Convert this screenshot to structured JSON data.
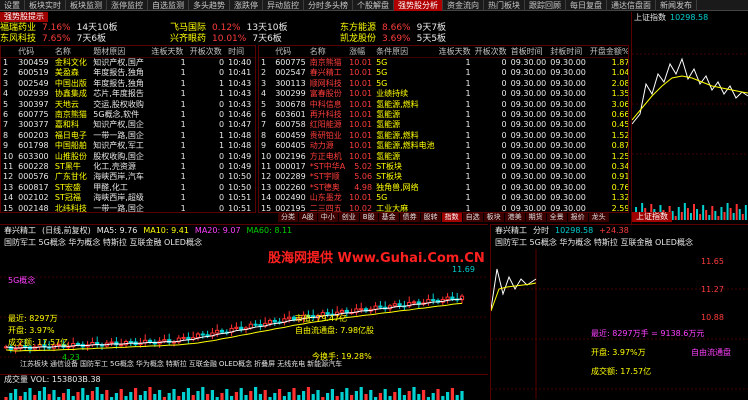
{
  "tabs": [
    "设置",
    "板块实时",
    "板块监测",
    "涨停监控",
    "自选监测",
    "多头趋势",
    "涨跌停",
    "异动监控",
    "分时多头榜",
    "个股解盘",
    "强势股分析",
    "资金流向",
    "热门板块",
    "跟踪回顾",
    "每日复盘",
    "通达信盘面",
    "新闻发布"
  ],
  "active_tab": "强势股分析",
  "subtab": "强势股提示",
  "summary": {
    "row1": [
      {
        "name": "福瑞药业",
        "pct": "7.16%",
        "tag": "14天10板"
      },
      {
        "name": "飞马国际",
        "pct": "0.12%",
        "tag": "13天10板"
      },
      {
        "name": "东方能源",
        "pct": "8.66%",
        "tag": "9天7板"
      }
    ],
    "row2": [
      {
        "name": "东风科技",
        "pct": "7.65%",
        "tag": "7天6板"
      },
      {
        "name": "兴齐眼药",
        "pct": "10.01%",
        "tag": "7天6板"
      },
      {
        "name": "凯龙股份",
        "pct": "3.69%",
        "tag": "5天5板"
      }
    ]
  },
  "left_table": {
    "headers": [
      "",
      "代码",
      "名称",
      "题材原因",
      "连板天数",
      "开板次数",
      "时间"
    ],
    "rows": [
      [
        "1",
        "300459",
        "金科文化",
        "知识产权,国产",
        "1",
        "0",
        "10:40"
      ],
      [
        "2",
        "600519",
        "美盈森",
        "年度报告,独角",
        "1",
        "0",
        "10:41"
      ],
      [
        "3",
        "002549",
        "中国出版",
        "年度报告,独角",
        "1",
        "1",
        "10:43"
      ],
      [
        "4",
        "002939",
        "协鑫集成",
        "芯片,年度报告",
        "1",
        "1",
        "10:43"
      ],
      [
        "5",
        "300397",
        "天地云",
        "交运,股权收购",
        "1",
        "0",
        "10:43"
      ],
      [
        "6",
        "600775",
        "南京熊猫",
        "5G概念,软件",
        "1",
        "0",
        "10:46"
      ],
      [
        "7",
        "300377",
        "嘉和科",
        "知识产权,国企",
        "1",
        "0",
        "10:47"
      ],
      [
        "8",
        "600203",
        "福日电子",
        "一带一路,国企",
        "1",
        "1",
        "10:48"
      ],
      [
        "9",
        "601798",
        "中国船舶",
        "知识产权,军工",
        "1",
        "1",
        "10:48"
      ],
      [
        "10",
        "603300",
        "山推股份",
        "股权收购,国企",
        "1",
        "0",
        "10:49"
      ],
      [
        "11",
        "600228",
        "ST黑牛",
        "化工,壳资源",
        "1",
        "0",
        "10:49"
      ],
      [
        "12",
        "000576",
        "广东甘化",
        "海峡西岸,汽车",
        "1",
        "0",
        "10:50"
      ],
      [
        "13",
        "600817",
        "ST宏盛",
        "甲醛,化工",
        "1",
        "0",
        "10:50"
      ],
      [
        "14",
        "002102",
        "ST冠福",
        "海峡西岸,超级",
        "1",
        "0",
        "10:51"
      ],
      [
        "15",
        "002148",
        "北纬科技",
        "一带一路,国企",
        "1",
        "0",
        "10:51"
      ]
    ]
  },
  "mid_table": {
    "headers": [
      "",
      "代码",
      "名称",
      "涨幅",
      "条件原因",
      "连板天数",
      "开板次数",
      "首板时间",
      "封板时间",
      "开盘金额%",
      "开盘金额"
    ],
    "rows": [
      [
        "1",
        "600775",
        "南京熊猫",
        "10.01",
        "5G",
        "1",
        "0",
        "09.30.00",
        "09.30.00",
        "1.87",
        "1.38亿"
      ],
      [
        "2",
        "002547",
        "春兴精工",
        "10.01",
        "5G",
        "1",
        "0",
        "09.30.00",
        "09.30.00",
        "1.04",
        "9138万"
      ],
      [
        "3",
        "300113",
        "顺网科技",
        "10.01",
        "5G",
        "1",
        "0",
        "09.30.00",
        "09.30.00",
        "2.08",
        "2619万"
      ],
      [
        "4",
        "300299",
        "富春股份",
        "10.01",
        "业绩持续",
        "1",
        "0",
        "09.30.00",
        "09.30.00",
        "1.35",
        "2458万"
      ],
      [
        "5",
        "300678",
        "中科信息",
        "10.01",
        "氢能源,燃料",
        "1",
        "0",
        "09.30.00",
        "09.30.00",
        "3.06",
        "2081万"
      ],
      [
        "6",
        "603601",
        "再升科技",
        "10.01",
        "氢能源",
        "1",
        "0",
        "09.30.00",
        "09.30.00",
        "0.66",
        "1.93亿"
      ],
      [
        "7",
        "600758",
        "红阳能源",
        "10.01",
        "氢能源",
        "1",
        "0",
        "09.30.00",
        "09.30.00",
        "0.45",
        "4050万"
      ],
      [
        "8",
        "600459",
        "贵研铂业",
        "10.01",
        "氢能源,燃料",
        "1",
        "0",
        "09.30.00",
        "09.30.00",
        "1.52",
        "2150万"
      ],
      [
        "9",
        "600405",
        "动力源",
        "10.01",
        "氢能源,燃料电池",
        "1",
        "0",
        "09.30.00",
        "09.30.00",
        "0.87",
        "2196万"
      ],
      [
        "10",
        "002196",
        "方正电机",
        "10.01",
        "氢能源",
        "1",
        "0",
        "09.30.00",
        "09.30.00",
        "1.25",
        "4523万"
      ],
      [
        "11",
        "000017",
        "*ST中华A",
        "5.02",
        "ST板块",
        "1",
        "0",
        "09.30.00",
        "09.30.00",
        "0.34",
        "2067万"
      ],
      [
        "12",
        "002289",
        "*ST宇顺",
        "5.06",
        "ST板块",
        "1",
        "0",
        "09.30.00",
        "09.30.00",
        "0.91",
        "2140万"
      ],
      [
        "13",
        "002260",
        "*ST德奥",
        "4.98",
        "独角兽,网络",
        "1",
        "0",
        "09.30.00",
        "09.30.00",
        "0.76",
        "2245万"
      ],
      [
        "14",
        "002490",
        "山东墨龙",
        "10.01",
        "5G",
        "1",
        "0",
        "09.30.00",
        "09.30.00",
        "1.32",
        "9168万"
      ],
      [
        "15",
        "002195",
        "二三四五",
        "10.02",
        "工业大麻",
        "1",
        "0",
        "09.30.00",
        "09.30.00",
        "2.59",
        "1.35亿"
      ]
    ]
  },
  "sel_tabs": [
    "分类",
    "A股",
    "中小",
    "创业",
    "B股",
    "基金",
    "债券",
    "股转",
    "指数",
    "自选",
    "板块",
    "港美",
    "期货",
    "全景",
    "报价",
    "龙头"
  ],
  "sel_active": "指数",
  "right_header": {
    "title": "上证指数",
    "value": "10298.58"
  },
  "right_badge": "上证指数",
  "kline": {
    "title": "春兴精工",
    "subtitle": "(日线,前复权)",
    "ma_labels": [
      "MA5: 9.76",
      "MA10: 9.41",
      "MA20: 9.07",
      "MA60: 8.11"
    ],
    "concept_line": "国防军工 5G概念 华为概念 特斯拉 互联金融 OLED概念",
    "price_top": "11.69",
    "price_low": "4.23",
    "ann": {
      "a1": "5G概念",
      "a2": "最近: 8297万",
      "a3": "开盘: 3.97%",
      "a4": "成交额: 17.57亿",
      "a5": "自由流通盘: 7.98亿股",
      "a6": "市值: 79.47亿",
      "a7": "今换手: 19.28%"
    },
    "concepts": [
      "江苏板块",
      "通信设备",
      "国防军工",
      "5G概念",
      "华为概念",
      "特斯拉",
      "互联金融",
      "OLED概念",
      "折叠屏",
      "无线充电",
      "新能源汽车"
    ],
    "vol_label": "成交量",
    "vol_value": "VOL: 153803B.38"
  },
  "intra": {
    "title": "春兴精工",
    "subtitle": "分时",
    "price": "10298.58",
    "change": "+24.38",
    "concept_line": "国防军工 5G概念 华为概念 特斯拉 互联金融 OLED概念",
    "ann1": "最近: 8297万手 = 9138.6万元",
    "ann2": "开盘: 3.97%万",
    "ann3": "成交额: 17.57亿",
    "ann4": "自由流通盘",
    "p1": "11.65",
    "p2": "11.27",
    "p3": "10.88"
  },
  "watermark": "股海网提供 Www.Guhai.Com.CN"
}
